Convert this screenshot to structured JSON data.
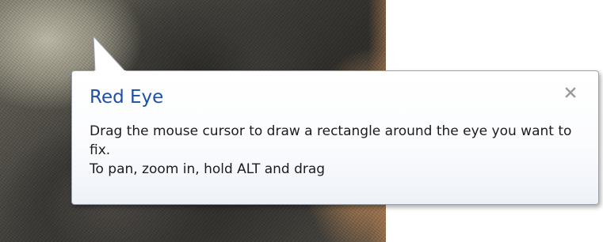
{
  "callout": {
    "title": "Red Eye",
    "close_icon": "close-icon",
    "lines": [
      "Drag the mouse cursor to draw a rectangle around the eye you want to fix.",
      "To pan, zoom in, hold ALT and drag"
    ]
  },
  "colors": {
    "title": "#1e4ea8",
    "body_text": "#1c1c1c",
    "callout_border": "#9aa3ad",
    "close_icon": "#9a9a9a"
  }
}
